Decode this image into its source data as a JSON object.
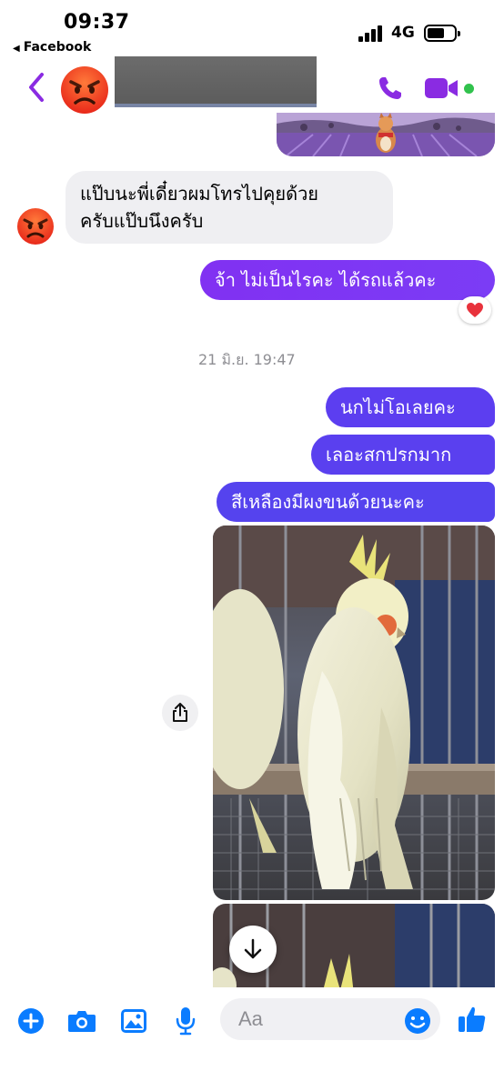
{
  "status_bar": {
    "time": "09:37",
    "back_app": "Facebook",
    "network": "4G"
  },
  "header": {
    "avatar_emoji": "😡",
    "contact_name_redacted": true,
    "icons": [
      "back-chevron-icon",
      "phone-icon",
      "video-camera-icon"
    ],
    "online": true
  },
  "messages": {
    "incoming_1": {
      "line1": "แป๊บนะพี่เดี๋ยวผมโทรไปคุยด้วย",
      "line2": "ครับแป๊บนึงครับ",
      "avatar_emoji": "😡"
    },
    "outgoing_1": {
      "text": "จ้า ไม่เป็นไรคะ ได้รถแล้วคะ",
      "reaction": "❤️"
    },
    "timestamp": "21 มิ.ย. 19:47",
    "outgoing_2": {
      "text": "นกไม่โอเลยคะ"
    },
    "outgoing_3": {
      "text": "เลอะสกปรกมาก"
    },
    "outgoing_4": {
      "text": "สีเหลืองมีผงขนด้วยนะคะ"
    }
  },
  "composer": {
    "placeholder": "Aa",
    "icons": [
      "plus-icon",
      "camera-icon",
      "gallery-icon",
      "microphone-icon",
      "emoji-icon",
      "like-icon"
    ]
  },
  "colors": {
    "accent": "#7b2ff7",
    "messenger_blue": "#0a7cff",
    "incoming_bubble": "#efeff2",
    "online": "#31c24d"
  }
}
